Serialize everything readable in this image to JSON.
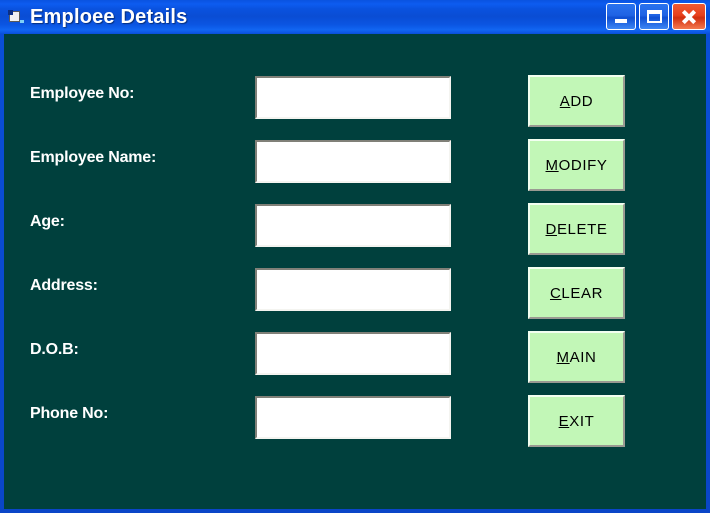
{
  "window": {
    "title": "Emploee Details",
    "icon": "form-document-icon",
    "background_color": "#00403D",
    "titlebar_color": "#0a52df"
  },
  "caption_buttons": [
    {
      "name": "minimize",
      "label": "Minimize"
    },
    {
      "name": "maximize",
      "label": "Maximize"
    },
    {
      "name": "close",
      "label": "Close"
    }
  ],
  "fields": [
    {
      "label": "Employee No:",
      "value": "",
      "placeholder": ""
    },
    {
      "label": "Employee Name:",
      "value": "",
      "placeholder": ""
    },
    {
      "label": "Age:",
      "value": "",
      "placeholder": ""
    },
    {
      "label": "Address:",
      "value": "",
      "placeholder": ""
    },
    {
      "label": "D.O.B:",
      "value": "",
      "placeholder": ""
    },
    {
      "label": "Phone No:",
      "value": "",
      "placeholder": ""
    }
  ],
  "buttons": [
    {
      "accel": "A",
      "rest": "DD",
      "label": "ADD"
    },
    {
      "accel": "M",
      "rest": "ODIFY",
      "label": "MODIFY"
    },
    {
      "accel": "D",
      "rest": "ELETE",
      "label": "DELETE"
    },
    {
      "accel": "C",
      "rest": "LEAR",
      "label": "CLEAR"
    },
    {
      "accel": "M",
      "rest": "AIN",
      "label": "MAIN"
    },
    {
      "accel": "E",
      "rest": "XIT",
      "label": "EXIT"
    }
  ],
  "colors": {
    "button_face": "#C2F7B7",
    "form_back": "#00403D",
    "text": "#FFFFFF",
    "close_button": "#E8401C"
  }
}
